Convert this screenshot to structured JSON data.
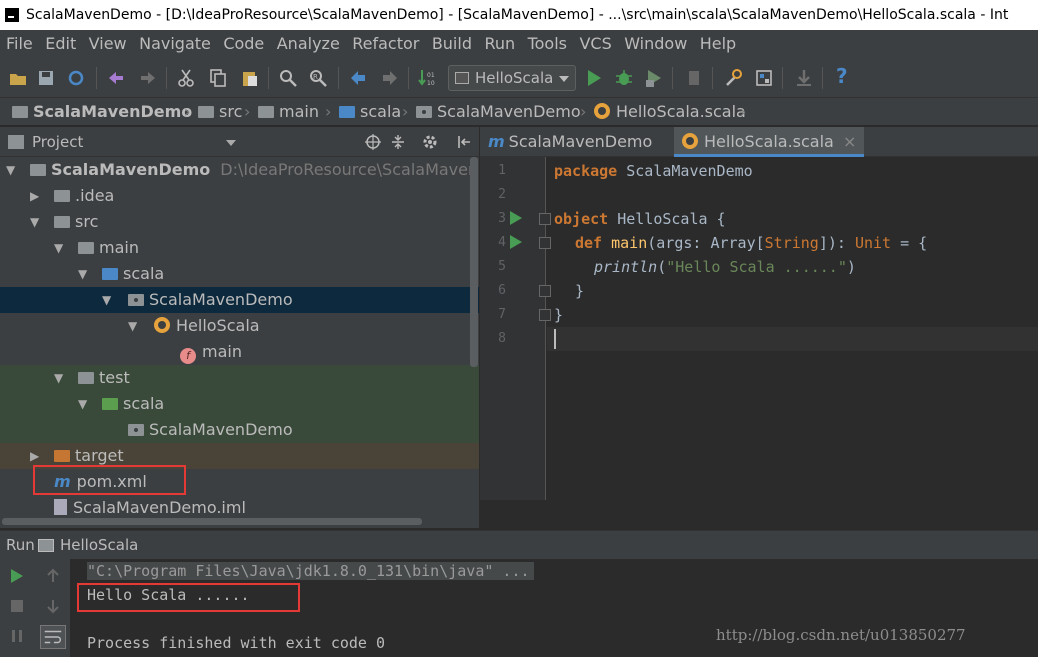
{
  "window": {
    "title": "ScalaMavenDemo - [D:\\IdeaProResource\\ScalaMavenDemo] - [ScalaMavenDemo] - ...\\src\\main\\scala\\ScalaMavenDemo\\HelloScala.scala - Int"
  },
  "menu": [
    "File",
    "Edit",
    "View",
    "Navigate",
    "Code",
    "Analyze",
    "Refactor",
    "Build",
    "Run",
    "Tools",
    "VCS",
    "Window",
    "Help"
  ],
  "toolbar": {
    "run_config": "HelloScala",
    "help": "?"
  },
  "breadcrumb": [
    "ScalaMavenDemo",
    "src",
    "main",
    "scala",
    "ScalaMavenDemo",
    "HelloScala.scala"
  ],
  "project": {
    "header": "Project",
    "tree": [
      {
        "label": "ScalaMavenDemo",
        "hint": "D:\\IdeaProResource\\ScalaMavenDem"
      },
      {
        "label": ".idea"
      },
      {
        "label": "src"
      },
      {
        "label": "main"
      },
      {
        "label": "scala"
      },
      {
        "label": "ScalaMavenDemo"
      },
      {
        "label": "HelloScala"
      },
      {
        "label": "main"
      },
      {
        "label": "test"
      },
      {
        "label": "scala"
      },
      {
        "label": "ScalaMavenDemo"
      },
      {
        "label": "target"
      },
      {
        "label": "pom.xml"
      },
      {
        "label": "ScalaMavenDemo.iml"
      }
    ]
  },
  "editor": {
    "tabs": [
      {
        "label": "ScalaMavenDemo",
        "icon": "m"
      },
      {
        "label": "HelloScala.scala",
        "icon": "scala-object",
        "close": "×"
      }
    ],
    "line_numbers": [
      "1",
      "2",
      "3",
      "4",
      "5",
      "6",
      "7",
      "8"
    ],
    "code": {
      "l1_kw": "package",
      "l1_rest": " ScalaMavenDemo",
      "l3_kw": "object",
      "l3_rest": " HelloScala {",
      "l4_kw": "def",
      "l4_fn": "main",
      "l4_args": "(args: Array[",
      "l4_type": "String",
      "l4_mid": "]): ",
      "l4_unit": "Unit",
      "l4_end": " = {",
      "l5_fn": "println",
      "l5_open": "(",
      "l5_str": "\"Hello Scala ......\"",
      "l5_close": ")",
      "l6": "}",
      "l7": "}"
    }
  },
  "run": {
    "label": "Run",
    "config": "HelloScala",
    "console": [
      "\"C:\\Program Files\\Java\\jdk1.8.0_131\\bin\\java\" ...",
      "Hello Scala ......",
      "",
      "Process finished with exit code 0"
    ]
  },
  "watermark": "http://blog.csdn.net/u013850277",
  "colors": {
    "keyword": "#cc7832",
    "string": "#6a8759",
    "function": "#ffc66d",
    "highlight": "#e53935",
    "run_green": "#499c54"
  }
}
